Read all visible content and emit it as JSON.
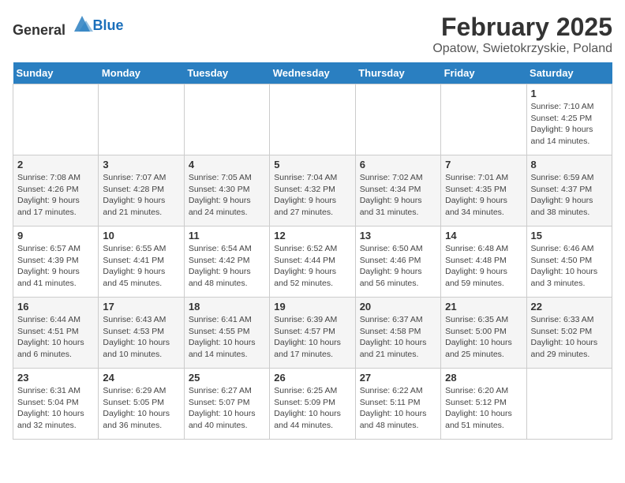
{
  "header": {
    "logo_general": "General",
    "logo_blue": "Blue",
    "title": "February 2025",
    "subtitle": "Opatow, Swietokrzyskie, Poland"
  },
  "days_of_week": [
    "Sunday",
    "Monday",
    "Tuesday",
    "Wednesday",
    "Thursday",
    "Friday",
    "Saturday"
  ],
  "weeks": [
    [
      {
        "day": "",
        "detail": ""
      },
      {
        "day": "",
        "detail": ""
      },
      {
        "day": "",
        "detail": ""
      },
      {
        "day": "",
        "detail": ""
      },
      {
        "day": "",
        "detail": ""
      },
      {
        "day": "",
        "detail": ""
      },
      {
        "day": "1",
        "detail": "Sunrise: 7:10 AM\nSunset: 4:25 PM\nDaylight: 9 hours and 14 minutes."
      }
    ],
    [
      {
        "day": "2",
        "detail": "Sunrise: 7:08 AM\nSunset: 4:26 PM\nDaylight: 9 hours and 17 minutes."
      },
      {
        "day": "3",
        "detail": "Sunrise: 7:07 AM\nSunset: 4:28 PM\nDaylight: 9 hours and 21 minutes."
      },
      {
        "day": "4",
        "detail": "Sunrise: 7:05 AM\nSunset: 4:30 PM\nDaylight: 9 hours and 24 minutes."
      },
      {
        "day": "5",
        "detail": "Sunrise: 7:04 AM\nSunset: 4:32 PM\nDaylight: 9 hours and 27 minutes."
      },
      {
        "day": "6",
        "detail": "Sunrise: 7:02 AM\nSunset: 4:34 PM\nDaylight: 9 hours and 31 minutes."
      },
      {
        "day": "7",
        "detail": "Sunrise: 7:01 AM\nSunset: 4:35 PM\nDaylight: 9 hours and 34 minutes."
      },
      {
        "day": "8",
        "detail": "Sunrise: 6:59 AM\nSunset: 4:37 PM\nDaylight: 9 hours and 38 minutes."
      }
    ],
    [
      {
        "day": "9",
        "detail": "Sunrise: 6:57 AM\nSunset: 4:39 PM\nDaylight: 9 hours and 41 minutes."
      },
      {
        "day": "10",
        "detail": "Sunrise: 6:55 AM\nSunset: 4:41 PM\nDaylight: 9 hours and 45 minutes."
      },
      {
        "day": "11",
        "detail": "Sunrise: 6:54 AM\nSunset: 4:42 PM\nDaylight: 9 hours and 48 minutes."
      },
      {
        "day": "12",
        "detail": "Sunrise: 6:52 AM\nSunset: 4:44 PM\nDaylight: 9 hours and 52 minutes."
      },
      {
        "day": "13",
        "detail": "Sunrise: 6:50 AM\nSunset: 4:46 PM\nDaylight: 9 hours and 56 minutes."
      },
      {
        "day": "14",
        "detail": "Sunrise: 6:48 AM\nSunset: 4:48 PM\nDaylight: 9 hours and 59 minutes."
      },
      {
        "day": "15",
        "detail": "Sunrise: 6:46 AM\nSunset: 4:50 PM\nDaylight: 10 hours and 3 minutes."
      }
    ],
    [
      {
        "day": "16",
        "detail": "Sunrise: 6:44 AM\nSunset: 4:51 PM\nDaylight: 10 hours and 6 minutes."
      },
      {
        "day": "17",
        "detail": "Sunrise: 6:43 AM\nSunset: 4:53 PM\nDaylight: 10 hours and 10 minutes."
      },
      {
        "day": "18",
        "detail": "Sunrise: 6:41 AM\nSunset: 4:55 PM\nDaylight: 10 hours and 14 minutes."
      },
      {
        "day": "19",
        "detail": "Sunrise: 6:39 AM\nSunset: 4:57 PM\nDaylight: 10 hours and 17 minutes."
      },
      {
        "day": "20",
        "detail": "Sunrise: 6:37 AM\nSunset: 4:58 PM\nDaylight: 10 hours and 21 minutes."
      },
      {
        "day": "21",
        "detail": "Sunrise: 6:35 AM\nSunset: 5:00 PM\nDaylight: 10 hours and 25 minutes."
      },
      {
        "day": "22",
        "detail": "Sunrise: 6:33 AM\nSunset: 5:02 PM\nDaylight: 10 hours and 29 minutes."
      }
    ],
    [
      {
        "day": "23",
        "detail": "Sunrise: 6:31 AM\nSunset: 5:04 PM\nDaylight: 10 hours and 32 minutes."
      },
      {
        "day": "24",
        "detail": "Sunrise: 6:29 AM\nSunset: 5:05 PM\nDaylight: 10 hours and 36 minutes."
      },
      {
        "day": "25",
        "detail": "Sunrise: 6:27 AM\nSunset: 5:07 PM\nDaylight: 10 hours and 40 minutes."
      },
      {
        "day": "26",
        "detail": "Sunrise: 6:25 AM\nSunset: 5:09 PM\nDaylight: 10 hours and 44 minutes."
      },
      {
        "day": "27",
        "detail": "Sunrise: 6:22 AM\nSunset: 5:11 PM\nDaylight: 10 hours and 48 minutes."
      },
      {
        "day": "28",
        "detail": "Sunrise: 6:20 AM\nSunset: 5:12 PM\nDaylight: 10 hours and 51 minutes."
      },
      {
        "day": "",
        "detail": ""
      }
    ]
  ]
}
